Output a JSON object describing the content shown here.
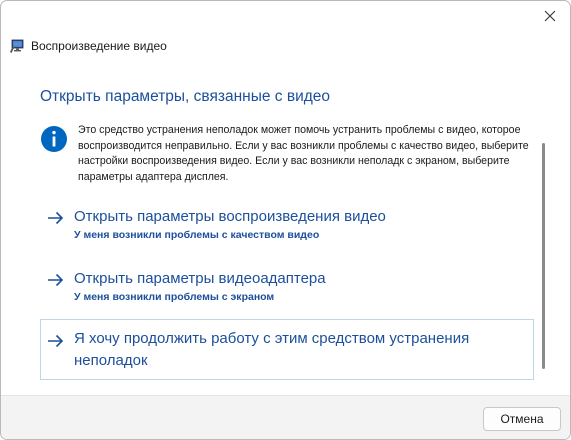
{
  "window": {
    "title": "Воспроизведение видео",
    "icon": "monitor-troubleshooter-icon"
  },
  "heading": "Открыть параметры, связанные с видео",
  "description": "Это средство устранения неполадок может помочь устранить проблемы с видео, которое воспроизводится неправильно. Если у вас возникли проблемы с качество видео, выберите настройки воспроизведения видео. Если у вас возникли неполадк с экраном, выберите параметры адаптера дисплея.",
  "options": [
    {
      "title": "Открыть параметры воспроизведения видео",
      "subtitle": "У меня возникли проблемы с качеством видео",
      "icon": "arrow-right-icon"
    },
    {
      "title": "Открыть параметры видеоадаптера",
      "subtitle": "У меня возникли проблемы с экраном",
      "icon": "arrow-right-icon"
    },
    {
      "title": "Я хочу продолжить работу с этим средством устранения неполадок",
      "icon": "arrow-right-icon"
    }
  ],
  "footer": {
    "cancel_label": "Отмена"
  },
  "colors": {
    "accent": "#1c4f9c",
    "info_blue": "#0067c0",
    "footer_bg": "#f3f3f3",
    "selected_border": "#bcd7e8"
  }
}
